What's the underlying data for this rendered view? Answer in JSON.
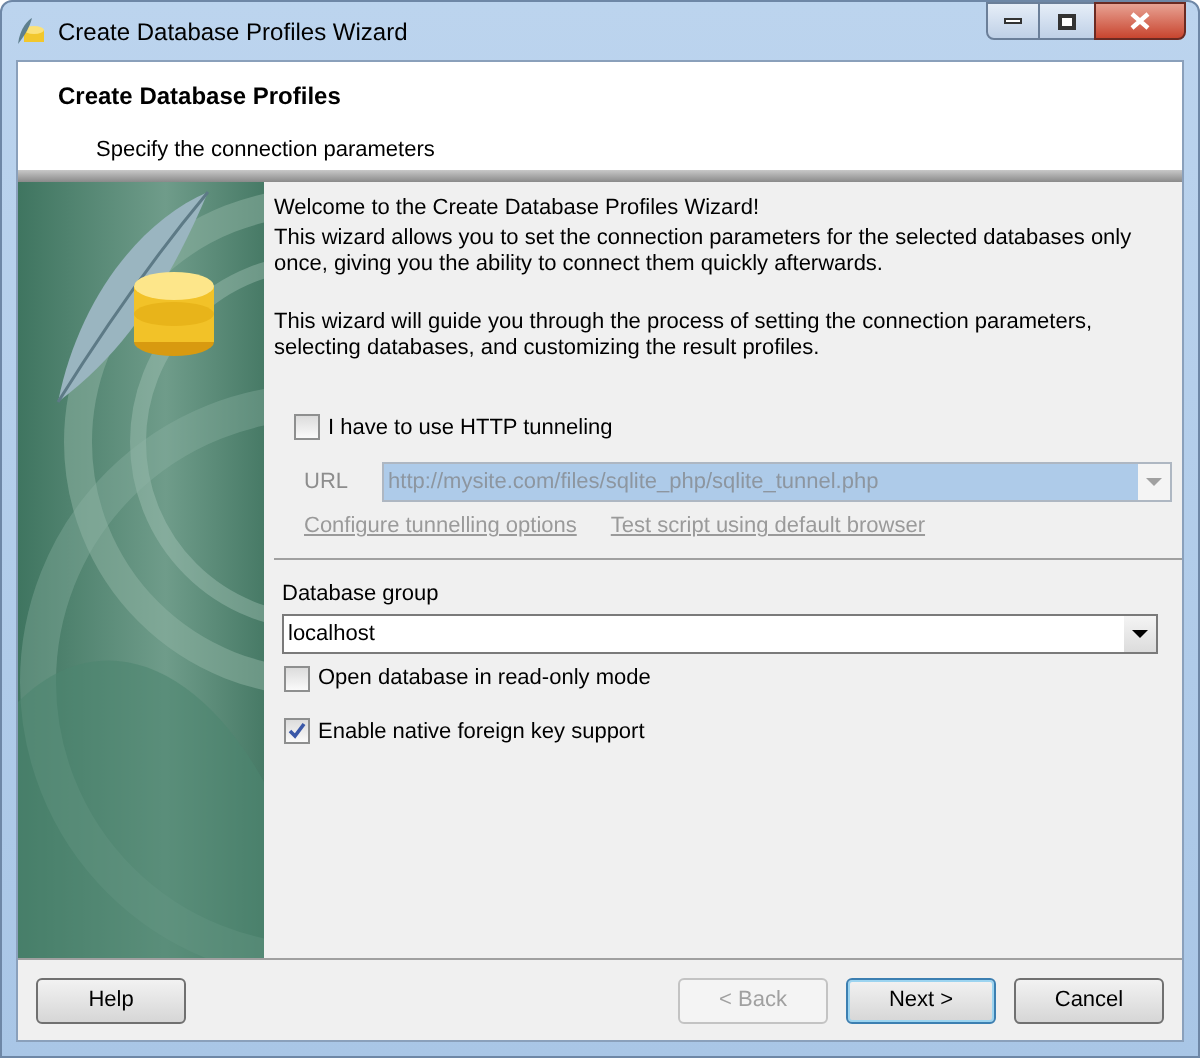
{
  "window": {
    "title": "Create Database Profiles Wizard"
  },
  "header": {
    "title": "Create Database Profiles",
    "subtitle": "Specify the connection parameters"
  },
  "intro": {
    "heading": "Welcome to the Create Database Profiles Wizard!",
    "line": "This wizard allows you to set the connection parameters for the selected databases only once, giving you the ability to connect them quickly afterwards.",
    "guide": "This wizard will guide you through the process of setting the connection parameters, selecting databases, and customizing the result profiles."
  },
  "tunneling": {
    "label": "I have to use HTTP tunneling",
    "checked": false,
    "url_label": "URL",
    "url": "http://mysite.com/files/sqlite_php/sqlite_tunnel.php",
    "disabled": true,
    "links": [
      "Configure tunnelling options",
      "Test script using default browser"
    ]
  },
  "database_group": {
    "label": "Database group",
    "value": "localhost"
  },
  "options": [
    {
      "label": "Open database in read-only mode",
      "checked": false
    },
    {
      "label": "Enable native foreign key support",
      "checked": true
    }
  ],
  "buttons": [
    {
      "label": "Help",
      "disabled": false,
      "default": false
    },
    {
      "label": "< Back",
      "disabled": true,
      "default": false
    },
    {
      "label": "Next >",
      "disabled": false,
      "default": true
    },
    {
      "label": "Cancel",
      "disabled": false,
      "default": false
    }
  ]
}
